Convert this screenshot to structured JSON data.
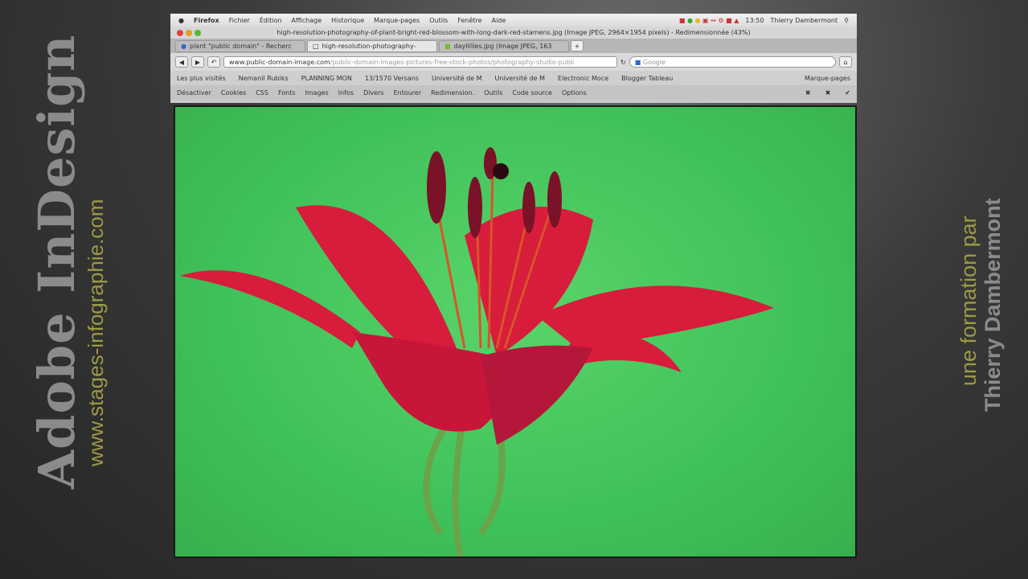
{
  "overlay": {
    "left_title": "Adobe InDesign",
    "left_url": "www.stages-infographie.com",
    "right_line1": "une formation par",
    "right_line2": "Thierry Dambermont"
  },
  "menubar": {
    "items": [
      "Firefox",
      "Fichier",
      "Édition",
      "Affichage",
      "Historique",
      "Marque-pages",
      "Outils",
      "Fenêtre",
      "Aide"
    ],
    "time": "13:50",
    "user": "Thierry Dambermont"
  },
  "window_title": "high-resolution-photography-of-plant-bright-red-blossom-with-long-dark-red-stamens.jpg (Image JPEG, 2964×1954 pixels) - Redimensionnée (43%)",
  "tabs": [
    {
      "label": "plant \"public domain\" - Recherc"
    },
    {
      "label": "high-resolution-photography-"
    },
    {
      "label": "daylillies.jpg (Image JPEG, 163"
    }
  ],
  "url": {
    "domain": "www.public-domain-image.com",
    "path": "/public-domain-images-pictures-free-stock-photos/photography-studio-publi"
  },
  "search_placeholder": "Google",
  "bookmarks": [
    "Les plus visités",
    "Nemanil Rubiks",
    "PLANNING MON",
    "13/1570 Versans",
    "Université de M",
    "Université de M",
    "Electronic Moce",
    "Blogger Tableau",
    "Marque-pages"
  ],
  "devtoolbar": [
    "Désactiver",
    "Cookies",
    "CSS",
    "Fonts",
    "Images",
    "Infos",
    "Divers",
    "Entourer",
    "Redimension.",
    "Outils",
    "Code source",
    "Options"
  ],
  "colors": {
    "accent_text": "#9c9a45",
    "petal": "#e0223e",
    "background_green": "#4cc85f"
  }
}
